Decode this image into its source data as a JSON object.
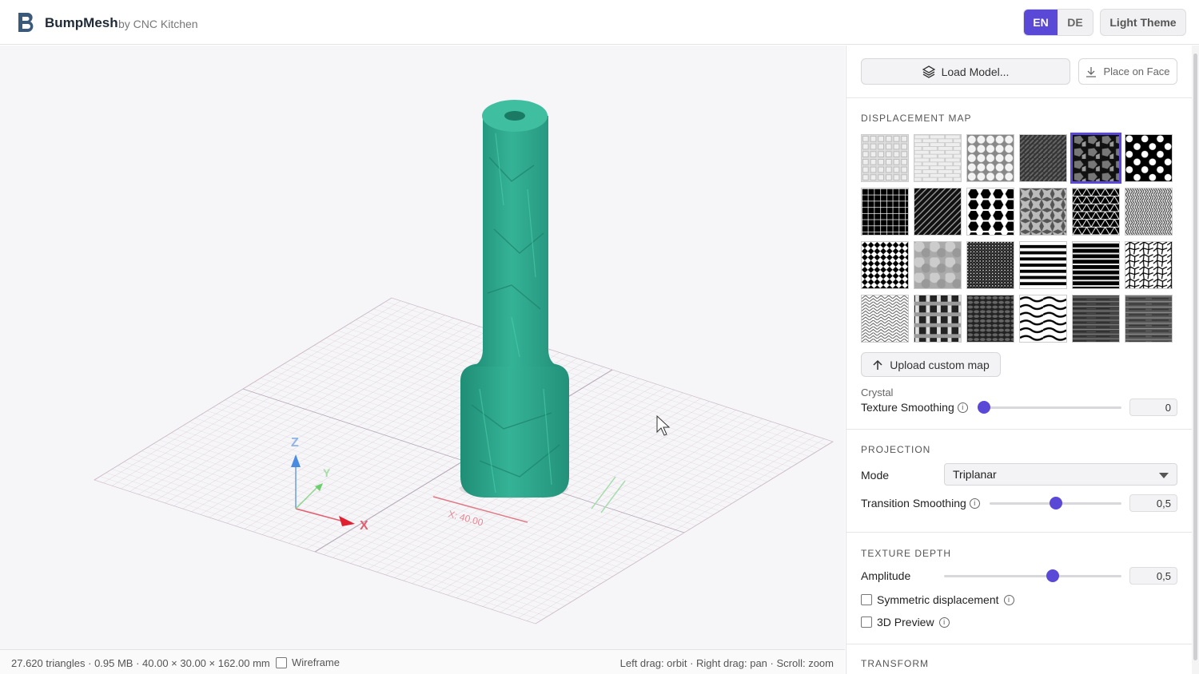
{
  "header": {
    "app_name": "BumpMesh",
    "app_sub": "by CNC Kitchen",
    "lang_en": "EN",
    "lang_de": "DE",
    "theme_button": "Light Theme"
  },
  "viewport": {
    "axis_x": "X",
    "axis_y": "Y",
    "axis_z": "Z",
    "dim_label": "X: 40.00"
  },
  "statusbar": {
    "stats": "27.620 triangles · 0.95 MB · 40.00 × 30.00 × 162.00 mm",
    "wireframe_label": "Wireframe",
    "hints": "Left drag: orbit · Right drag: pan · Scroll: zoom"
  },
  "panel": {
    "load_model": "Load Model...",
    "place_on_face": "Place on Face",
    "displacement_title": "DISPLACEMENT MAP",
    "upload_custom": "Upload custom map",
    "selected_map_name": "Crystal",
    "texture_smoothing_label": "Texture Smoothing",
    "texture_smoothing_value": "0",
    "projection_title": "PROJECTION",
    "mode_label": "Mode",
    "mode_value": "Triplanar",
    "transition_smoothing_label": "Transition Smoothing",
    "transition_smoothing_value": "0,5",
    "texture_depth_title": "TEXTURE DEPTH",
    "amplitude_label": "Amplitude",
    "amplitude_value": "0,5",
    "symmetric_label": "Symmetric displacement",
    "preview3d_label": "3D Preview",
    "transform_title": "TRANSFORM"
  },
  "sliders": {
    "texture_smoothing": 0.0,
    "transition_smoothing": 0.5,
    "amplitude": 0.62
  },
  "colors": {
    "accent": "#5a48d6",
    "model": "#2fa88e"
  },
  "icons": {
    "load": "layers-icon",
    "place": "download-icon",
    "upload": "arrow-up-icon",
    "info": "info-icon"
  }
}
